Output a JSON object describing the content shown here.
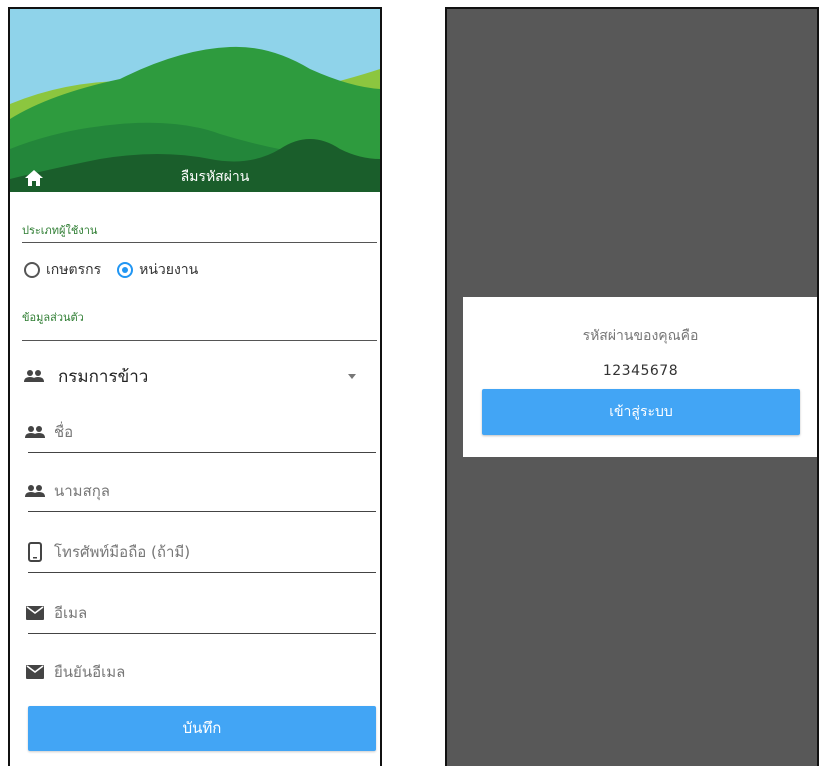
{
  "register_screen": {
    "header": {
      "title": "ลืมรหัสผ่าน",
      "home_icon": "home-icon"
    },
    "user_type": {
      "label": "ประเภทผู้ใช้งาน",
      "options": [
        {
          "label": "เกษตรกร",
          "selected": false
        },
        {
          "label": "หน่วยงาน",
          "selected": true
        }
      ]
    },
    "personal_info": {
      "label": "ข้อมูลส่วนตัว",
      "department_select": {
        "value": "กรมการข้าว",
        "icon": "people-icon"
      },
      "fields": [
        {
          "placeholder": "ชื่อ",
          "icon": "people-icon"
        },
        {
          "placeholder": "นามสกุล",
          "icon": "people-icon"
        },
        {
          "placeholder": "โทรศัพท์มือถือ (ถ้ามี)",
          "icon": "phone-icon"
        },
        {
          "placeholder": "อีเมล",
          "icon": "mail-icon"
        },
        {
          "placeholder": "ยืนยันอีเมล",
          "icon": "mail-icon"
        }
      ]
    },
    "save_button": "บันทึก"
  },
  "result_dialog": {
    "title": "รหัสผ่านของคุณคือ",
    "password": "12345678",
    "login_button": "เข้าสู่ระบบ"
  },
  "colors": {
    "accent": "#42a5f5",
    "label_green": "#2e7d32",
    "overlay": "#585858"
  }
}
